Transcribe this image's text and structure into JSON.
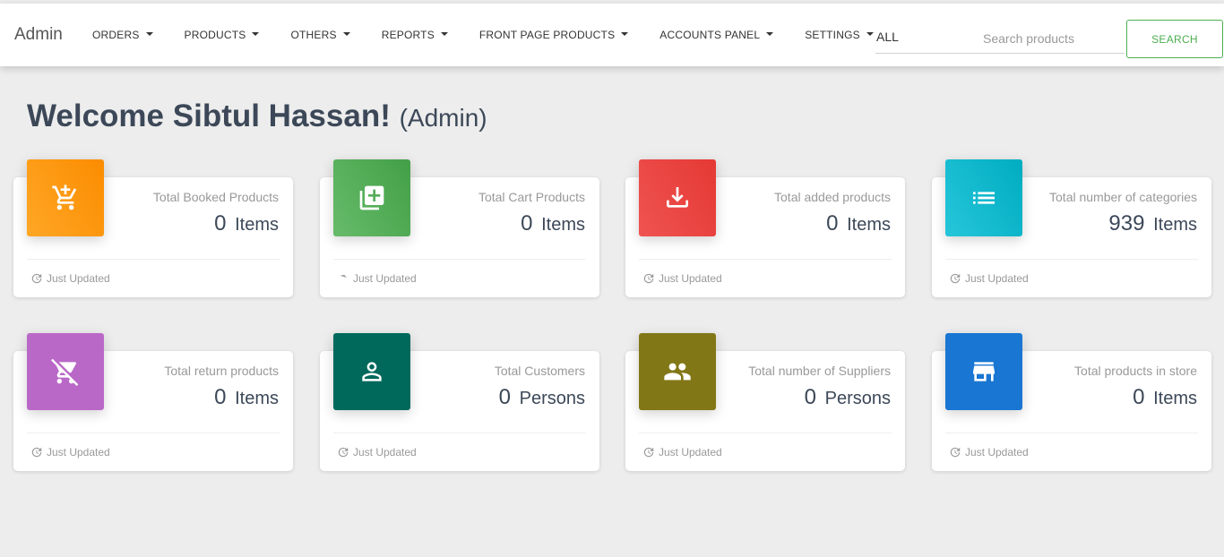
{
  "navbar": {
    "brand": "Admin",
    "menu": [
      {
        "label": "ORDERS",
        "name": "nav-orders"
      },
      {
        "label": "PRODUCTS",
        "name": "nav-products"
      },
      {
        "label": "OTHERS",
        "name": "nav-others"
      },
      {
        "label": "REPORTS",
        "name": "nav-reports"
      },
      {
        "label": "FRONT PAGE PRODUCTS",
        "name": "nav-front-page-products"
      },
      {
        "label": "ACCOUNTS PANEL",
        "name": "nav-accounts-panel"
      },
      {
        "label": "SETTINGS",
        "name": "nav-settings"
      }
    ],
    "filter_value": "ALL",
    "search_placeholder": "Search products",
    "search_button": "SEARCH"
  },
  "welcome": {
    "greeting": "Welcome Sibtul Hassan!",
    "role": "(Admin)"
  },
  "cards": [
    {
      "category": "Total Booked Products",
      "value": "0",
      "unit": "Items",
      "footer": "Just Updated",
      "color": "#ff9800",
      "icon": "add-shopping-cart-icon"
    },
    {
      "category": "Total Cart Products",
      "value": "0",
      "unit": "Items",
      "footer": "Just Updated",
      "color": "#4caf50",
      "icon": "library-add-icon"
    },
    {
      "category": "Total added products",
      "value": "0",
      "unit": "Items",
      "footer": "Just Updated",
      "color": "#e53935",
      "icon": "download-icon"
    },
    {
      "category": "Total number of categories",
      "value": "939",
      "unit": "Items",
      "footer": "Just Updated",
      "color": "#00acc1",
      "icon": "list-icon"
    },
    {
      "category": "Total return products",
      "value": "0",
      "unit": "Items",
      "footer": "Just Updated",
      "color": "#ba68c8",
      "icon": "remove-shopping-cart-icon"
    },
    {
      "category": "Total Customers",
      "value": "0",
      "unit": "Persons",
      "footer": "Just Updated",
      "color": "#00695c",
      "icon": "person-icon"
    },
    {
      "category": "Total number of Suppliers",
      "value": "0",
      "unit": "Persons",
      "footer": "Just Updated",
      "color": "#827717",
      "icon": "people-icon"
    },
    {
      "category": "Total products in store",
      "value": "0",
      "unit": "Items",
      "footer": "Just Updated",
      "color": "#1976d2",
      "icon": "store-icon"
    }
  ]
}
